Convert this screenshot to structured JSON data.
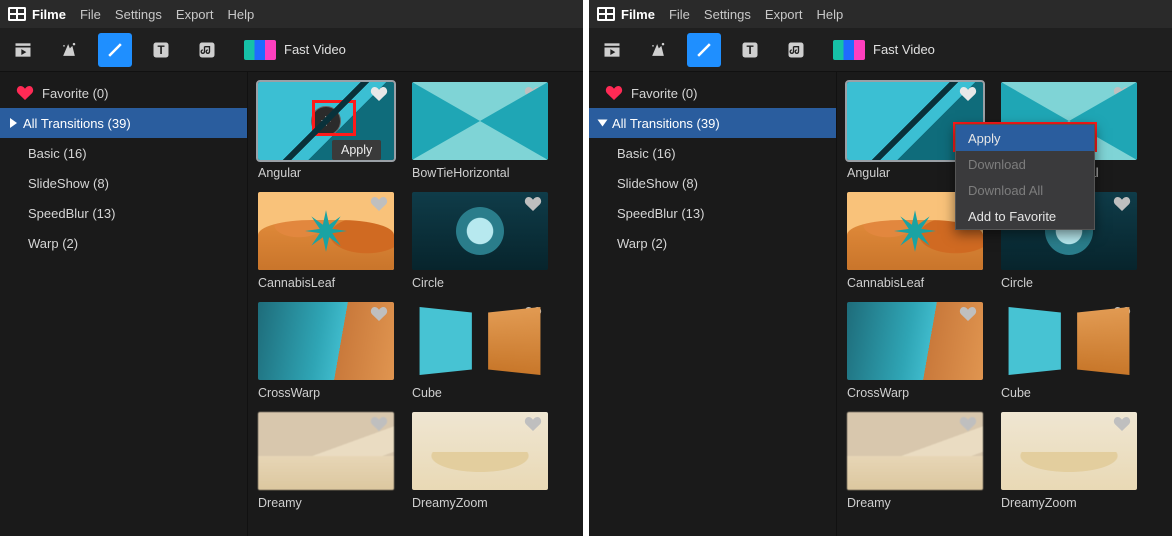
{
  "app_name": "Filme",
  "menubar": {
    "items": [
      "File",
      "Settings",
      "Export",
      "Help"
    ]
  },
  "toolbar": {
    "fast_video_label": "Fast Video"
  },
  "sidebar": {
    "favorite": {
      "label": "Favorite (0)"
    },
    "all": {
      "label": "All Transitions (39)"
    },
    "items": [
      {
        "label": "Basic (16)"
      },
      {
        "label": "SlideShow (8)"
      },
      {
        "label": "SpeedBlur (13)"
      },
      {
        "label": "Warp (2)"
      }
    ]
  },
  "transitions": [
    {
      "name": "Angular"
    },
    {
      "name": "BowTieHorizontal"
    },
    {
      "name": "CannabisLeaf"
    },
    {
      "name": "Circle"
    },
    {
      "name": "CrossWarp"
    },
    {
      "name": "Cube"
    },
    {
      "name": "Dreamy"
    },
    {
      "name": "DreamyZoom"
    }
  ],
  "tooltip": {
    "apply": "Apply"
  },
  "context_menu": {
    "apply": "Apply",
    "download": "Download",
    "download_all": "Download All",
    "add_favorite": "Add to Favorite"
  },
  "colors": {
    "accent": "#1f8fff",
    "selection": "#2a5d9e",
    "highlight_box": "#ff1a1a",
    "favorite_heart": "#ff2a55"
  }
}
